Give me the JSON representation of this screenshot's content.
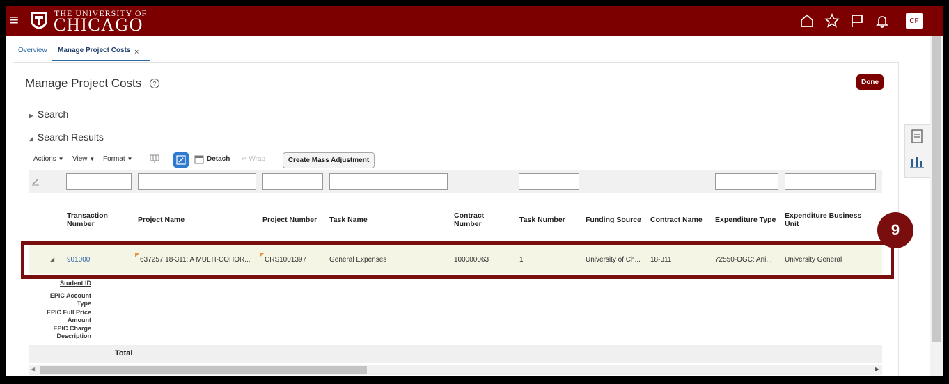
{
  "header": {
    "university_line1": "THE UNIVERSITY OF",
    "university_line2": "CHICAGO",
    "avatar_initials": "CF",
    "brand_color": "#7c0000"
  },
  "tabs": [
    {
      "label": "Overview"
    },
    {
      "label": "Manage Project Costs"
    }
  ],
  "page": {
    "title": "Manage Project Costs",
    "done_label": "Done"
  },
  "sections": {
    "search": "Search",
    "results": "Search Results"
  },
  "toolbar": {
    "actions": "Actions",
    "view": "View",
    "format": "Format",
    "detach": "Detach",
    "wrap": "Wrap",
    "create_mass_adjustment": "Create Mass Adjustment"
  },
  "table": {
    "columns": [
      {
        "l1": "Transaction",
        "l2": "Number"
      },
      {
        "l1": "Project Name",
        "l2": ""
      },
      {
        "l1": "Project Number",
        "l2": ""
      },
      {
        "l1": "Task Name",
        "l2": ""
      },
      {
        "l1": "Contract",
        "l2": "Number"
      },
      {
        "l1": "Task Number",
        "l2": ""
      },
      {
        "l1": "Funding Source",
        "l2": ""
      },
      {
        "l1": "Contract Name",
        "l2": ""
      },
      {
        "l1": "Expenditure Type",
        "l2": ""
      },
      {
        "l1": "Expenditure Business",
        "l2": "Unit"
      }
    ],
    "row": {
      "transaction_number": "901000",
      "project_name": "637257 18-311: A MULTI-COHOR...",
      "project_number": "CRS1001397",
      "task_name": "General Expenses",
      "contract_number": "100000063",
      "task_number": "1",
      "funding_source": "University of Ch...",
      "contract_name": "18-311",
      "expenditure_type": "72550-OGC: Ani...",
      "expenditure_business_unit": "University General"
    },
    "detail_labels": {
      "student_id": "Student ID",
      "epic_account_1": "EPIC Account",
      "epic_account_2": "Type",
      "epic_full_1": "EPIC Full Price",
      "epic_full_2": "Amount",
      "epic_charge_1": "EPIC Charge",
      "epic_charge_2": "Description"
    },
    "total_label": "Total"
  },
  "callout": {
    "step": "9"
  }
}
